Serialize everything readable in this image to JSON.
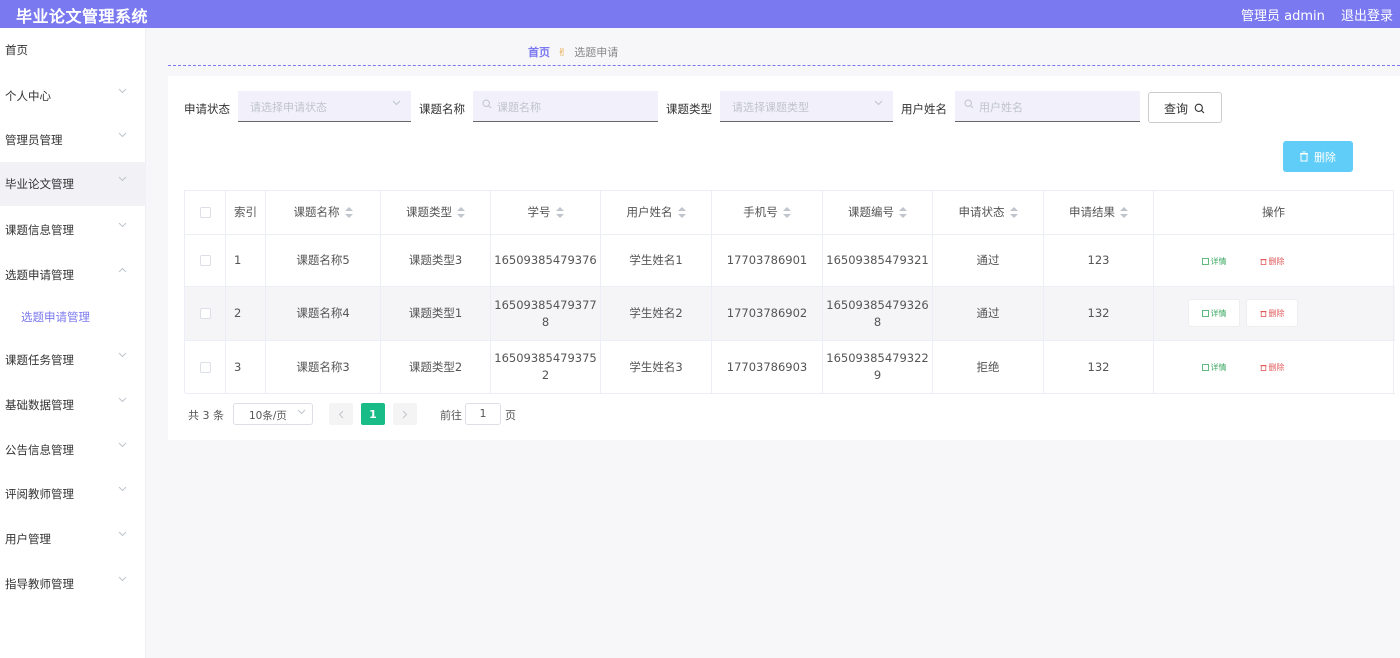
{
  "header": {
    "app_title": "毕业论文管理系统",
    "user_label": "管理员 admin",
    "logout_label": "退出登录"
  },
  "sidebar": {
    "items": [
      {
        "label": "首页",
        "chevron": false
      },
      {
        "label": "个人中心",
        "chevron": true
      },
      {
        "label": "管理员管理",
        "chevron": true
      },
      {
        "label": "毕业论文管理",
        "chevron": true,
        "active": true
      },
      {
        "label": "课题信息管理",
        "chevron": true
      },
      {
        "label": "选题申请管理",
        "chevron": true,
        "expanded": true
      },
      {
        "label": "课题任务管理",
        "chevron": true
      },
      {
        "label": "基础数据管理",
        "chevron": true
      },
      {
        "label": "公告信息管理",
        "chevron": true
      },
      {
        "label": "评阅教师管理",
        "chevron": true
      },
      {
        "label": "用户管理",
        "chevron": true
      },
      {
        "label": "指导教师管理",
        "chevron": true
      }
    ],
    "submenu": {
      "label": "选题申请管理"
    }
  },
  "breadcrumb": {
    "home": "首页",
    "current": "选题申请"
  },
  "filters": {
    "status_label": "申请状态",
    "status_placeholder": "请选择申请状态",
    "topic_name_label": "课题名称",
    "topic_name_placeholder": "课题名称",
    "topic_type_label": "课题类型",
    "topic_type_placeholder": "请选择课题类型",
    "username_label": "用户姓名",
    "username_placeholder": "用户姓名",
    "search_label": "查询"
  },
  "toolbar": {
    "delete_label": "删除"
  },
  "table": {
    "columns": [
      "索引",
      "课题名称",
      "课题类型",
      "学号",
      "用户姓名",
      "手机号",
      "课题编号",
      "申请状态",
      "申请结果",
      "操作"
    ],
    "rows": [
      {
        "index": "1",
        "topic_name": "课题名称5",
        "topic_type": "课题类型3",
        "student_id_a": "16509385479376",
        "student_id_b": "",
        "username": "学生姓名1",
        "phone": "17703786901",
        "topic_no_a": "16509385479321",
        "topic_no_b": "",
        "status": "通过",
        "result": "123"
      },
      {
        "index": "2",
        "topic_name": "课题名称4",
        "topic_type": "课题类型1",
        "student_id_a": "16509385479377",
        "student_id_b": "8",
        "username": "学生姓名2",
        "phone": "17703786902",
        "topic_no_a": "16509385479326",
        "topic_no_b": "8",
        "status": "通过",
        "result": "132"
      },
      {
        "index": "3",
        "topic_name": "课题名称3",
        "topic_type": "课题类型2",
        "student_id_a": "16509385479375",
        "student_id_b": "2",
        "username": "学生姓名3",
        "phone": "17703786903",
        "topic_no_a": "16509385479322",
        "topic_no_b": "9",
        "status": "拒绝",
        "result": "132"
      }
    ],
    "detail_label": "详情",
    "delete_label": "删除"
  },
  "pagination": {
    "total_label": "共 3 条",
    "page_size": "10条/页",
    "current_page": "1",
    "goto_label": "前往",
    "goto_value": "1",
    "goto_suffix": "页"
  },
  "colors": {
    "header": "#7b79f0",
    "delete_button": "#5fcdf7",
    "active_page": "#19bb86",
    "detail_text": "#3aa861",
    "delete_text": "#e05a5a"
  }
}
